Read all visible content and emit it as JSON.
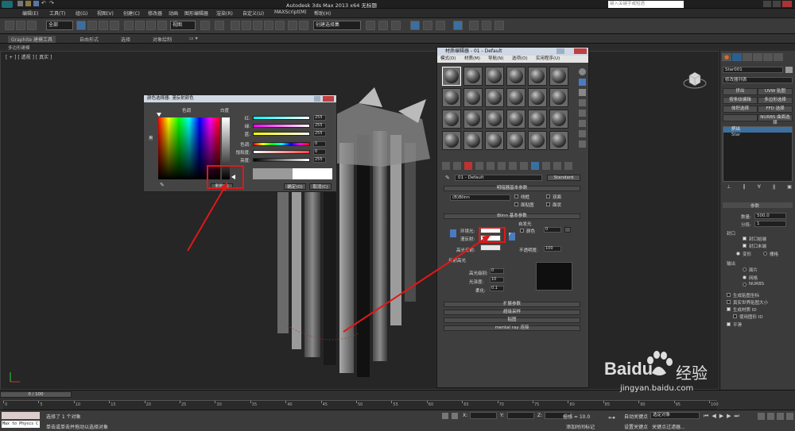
{
  "titlebar": {
    "title": "Autodesk 3ds Max  2013 x64    无标题",
    "search_placeholder": "键入关键字或短语"
  },
  "menu": [
    "编辑(E)",
    "工具(T)",
    "组(G)",
    "视图(V)",
    "创建(C)",
    "修改器",
    "动画",
    "图形编辑器",
    "渲染(R)",
    "自定义(U)",
    "MAXScript(M)",
    "帮助(H)"
  ],
  "toolbar": {
    "selection_filter": "全部",
    "view_dropdown": "视图",
    "named_set": "创建选择集"
  },
  "ribbon": {
    "tabs": [
      "Graphite 建模工具",
      "自由形式",
      "选择",
      "对象绘制"
    ],
    "sub_label": "多边形建模"
  },
  "viewport": {
    "label": "[ + ] [ 透视 ] [ 真实 ]"
  },
  "color_dialog": {
    "title": "颜色选择器: 漫反射颜色",
    "hue_label": "色调",
    "white_label": "白度",
    "black_label": "黑",
    "sliders": [
      {
        "label": "红:",
        "value": "255",
        "color": "#ff0000"
      },
      {
        "label": "绿:",
        "value": "255",
        "color": "#00ff00"
      },
      {
        "label": "蓝:",
        "value": "255",
        "color": "#0000ff"
      },
      {
        "label": "色调:",
        "value": "0",
        "color": "#ff00ff"
      },
      {
        "label": "饱和度:",
        "value": "0",
        "color": "#ff0000"
      },
      {
        "label": "亮度:",
        "value": "255",
        "color": "#ffffff"
      }
    ],
    "reset_button": "重置(R)",
    "ok_button": "确定(O)",
    "cancel_button": "取消(C)"
  },
  "material_editor": {
    "title": "材质编辑器 - 01 - Default",
    "menu": [
      "模式(D)",
      "材质(M)",
      "导航(N)",
      "选项(O)",
      "实用程序(U)"
    ],
    "material_name": "01 - Default",
    "material_type": "Standard",
    "shader_rollout": "明暗器基本参数",
    "shader": "(B)Blinn",
    "shader_options": [
      "线框",
      "双面",
      "面贴图",
      "面状"
    ],
    "blinn_rollout": "Blinn 基本参数",
    "self_illum": "自发光",
    "color_label": "颜色",
    "color_value": "0",
    "ambient_label": "环境光:",
    "diffuse_label": "漫反射:",
    "specular_label": "高光反射:",
    "opacity_label": "不透明度:",
    "opacity_value": "100",
    "specular_group": "反射高光",
    "spec_level_label": "高光级别:",
    "spec_level_value": "0",
    "gloss_label": "光泽度:",
    "gloss_value": "10",
    "soften_label": "柔化:",
    "soften_value": "0.1",
    "rollouts": [
      "扩展参数",
      "超级采样",
      "贴图",
      "mental ray 连接"
    ]
  },
  "command_panel": {
    "object_name": "Star001",
    "modifier_list": "修改器列表",
    "buttons": [
      "挤出",
      "UVW 贴图",
      "按条纹编辑",
      "多边形选择",
      "体积选择",
      "FFD 选择",
      "",
      "NURBS 曲面选择"
    ],
    "stack": [
      "挤出",
      "Star"
    ],
    "params_title": "参数",
    "amount_label": "数量:",
    "amount_value": "500.0",
    "segments_label": "分段:",
    "segments_value": "1",
    "capping_title": "封口",
    "cap_start": "封口始端",
    "cap_end": "封口末端",
    "morph": "变形",
    "grid": "栅格",
    "output_title": "输出",
    "patch": "面片",
    "mesh": "网格",
    "nurbs": "NURBS",
    "gen_map": "生成贴图坐标",
    "real_world": "真实世界贴图大小",
    "gen_matid": "生成材质 ID",
    "use_shape_id": "使用图形 ID",
    "smooth": "平滑"
  },
  "timeline": {
    "frame": "0 / 100",
    "ticks": [
      "0",
      "5",
      "10",
      "15",
      "20",
      "25",
      "30",
      "35",
      "40",
      "45",
      "50",
      "55",
      "60",
      "65",
      "70",
      "75",
      "80",
      "85",
      "90",
      "95",
      "100"
    ]
  },
  "status": {
    "selected": "选择了 1 个对象",
    "hint": "单击或单击并拖动以选择对象",
    "script": "Max to Physcs C",
    "x_label": "X:",
    "y_label": "Y:",
    "z_label": "Z:",
    "grid": "栅格 = 10.0",
    "auto_key": "自动关键点",
    "selection": "选定对象",
    "set_key": "设置关键点",
    "key_filter": "关键点过滤器...",
    "add_time_tag": "添加时间标记"
  },
  "watermark": {
    "brand": "Baidu",
    "brand_cn": "经验",
    "url": "jingyan.baidu.com"
  }
}
